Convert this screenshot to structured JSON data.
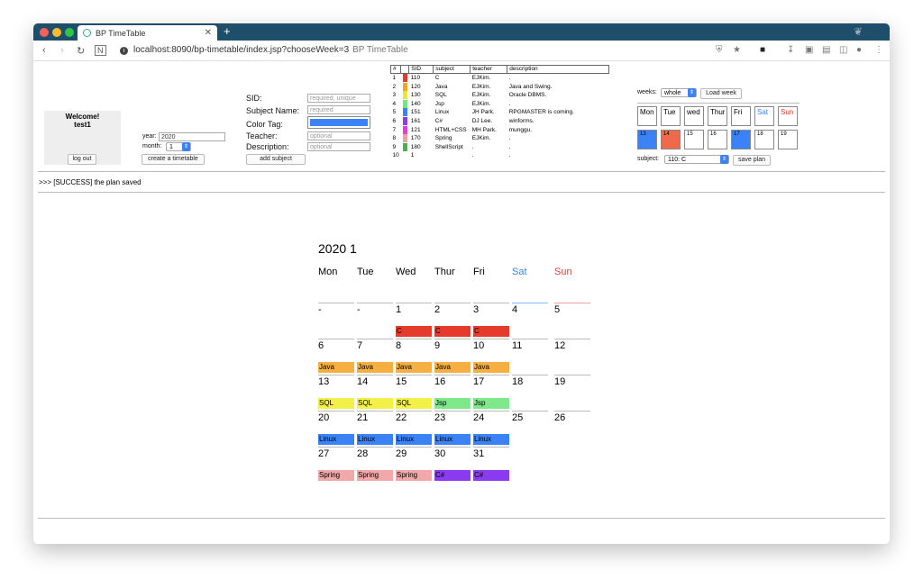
{
  "browser": {
    "tab_title": "BP TimeTable",
    "url": "localhost:8090/bp-timetable/index.jsp?chooseWeek=3",
    "page_title_hint": "BP TimeTable"
  },
  "login": {
    "welcome": "Welcome!",
    "user": "test1",
    "logout_label": "log out"
  },
  "create": {
    "year_label": "year:",
    "year_value": "2020",
    "month_label": "month:",
    "month_value": "1",
    "create_label": "create a timetable"
  },
  "subject_form": {
    "sid_label": "SID:",
    "sid_placeholder": "required, unique",
    "name_label": "Subject Name:",
    "name_placeholder": "required",
    "color_label": "Color Tag:",
    "color_value": "#3b82f6",
    "teacher_label": "Teacher:",
    "teacher_placeholder": "optional",
    "desc_label": "Description:",
    "desc_placeholder": "optional",
    "add_label": "add subject"
  },
  "subject_table": {
    "headers": [
      "#",
      "",
      "SID",
      "subject",
      "teacher",
      "description"
    ],
    "rows": [
      {
        "n": "1",
        "color": "#e53b2c",
        "sid": "110",
        "subject": "C",
        "teacher": "EJKim.",
        "desc": "."
      },
      {
        "n": "2",
        "color": "#f5a623",
        "sid": "120",
        "subject": "Java",
        "teacher": "EJKim.",
        "desc": "Java and Swing."
      },
      {
        "n": "3",
        "color": "#e8e832",
        "sid": "130",
        "subject": "SQL",
        "teacher": "EJKim.",
        "desc": "Oracle DBMS."
      },
      {
        "n": "4",
        "color": "#6fe87e",
        "sid": "140",
        "subject": "Jsp",
        "teacher": "EJKim.",
        "desc": "."
      },
      {
        "n": "5",
        "color": "#3b82f6",
        "sid": "151",
        "subject": "Linux",
        "teacher": "JH Park.",
        "desc": "RPGMASTER is coming."
      },
      {
        "n": "6",
        "color": "#8b3bf0",
        "sid": "161",
        "subject": "C#",
        "teacher": "DJ Lee.",
        "desc": "winforms."
      },
      {
        "n": "7",
        "color": "#e83bd8",
        "sid": "121",
        "subject": "HTML+CSS",
        "teacher": "MH Park.",
        "desc": "munggu."
      },
      {
        "n": "8",
        "color": "#f0a0a0",
        "sid": "170",
        "subject": "Spring",
        "teacher": "EJKim.",
        "desc": "."
      },
      {
        "n": "9",
        "color": "#4caf50",
        "sid": "180",
        "subject": "ShellScript",
        "teacher": ".",
        "desc": "."
      },
      {
        "n": "10",
        "color": "",
        "sid": "1",
        "subject": "",
        "teacher": ".",
        "desc": "."
      }
    ]
  },
  "week_panel": {
    "weeks_label": "weeks:",
    "weeks_value": "whole",
    "load_label": "Load week",
    "days": [
      {
        "name": "Mon",
        "color": "#000000",
        "num": "13",
        "fill": "#3b82f6"
      },
      {
        "name": "Tue",
        "color": "#000000",
        "num": "14",
        "fill": "#ef6a4c"
      },
      {
        "name": "wed",
        "color": "#000000",
        "num": "15",
        "fill": ""
      },
      {
        "name": "Thur",
        "color": "#000000",
        "num": "16",
        "fill": ""
      },
      {
        "name": "Fri",
        "color": "#000000",
        "num": "17",
        "fill": "#3b82f6"
      },
      {
        "name": "Sat",
        "color": "#3b82f6",
        "num": "18",
        "fill": ""
      },
      {
        "name": "Sun",
        "color": "#e53b2c",
        "num": "19",
        "fill": ""
      }
    ],
    "subject_label": "subject:",
    "subject_value": "110: C",
    "save_label": "save plan"
  },
  "message": ">>> [SUCCESS] the plan saved",
  "calendar": {
    "title": "2020 1",
    "dow": [
      {
        "label": "Mon",
        "color": "#000000"
      },
      {
        "label": "Tue",
        "color": "#000000"
      },
      {
        "label": "Wed",
        "color": "#000000"
      },
      {
        "label": "Thur",
        "color": "#000000"
      },
      {
        "label": "Fri",
        "color": "#000000"
      },
      {
        "label": "Sat",
        "color": "#3b82f6"
      },
      {
        "label": "Sun",
        "color": "#e53b2c"
      }
    ],
    "weeks": [
      [
        {
          "num": "-",
          "line": "#bbbbbb",
          "bar": "",
          "bar_color": ""
        },
        {
          "num": "-",
          "line": "#bbbbbb",
          "bar": "",
          "bar_color": ""
        },
        {
          "num": "1",
          "line": "#bbbbbb",
          "bar": "C",
          "bar_color": "#e53b2c"
        },
        {
          "num": "2",
          "line": "#bbbbbb",
          "bar": "C",
          "bar_color": "#e53b2c"
        },
        {
          "num": "3",
          "line": "#bbbbbb",
          "bar": "C",
          "bar_color": "#e53b2c"
        },
        {
          "num": "4",
          "line": "#8ab4f8",
          "bar": "",
          "bar_color": ""
        },
        {
          "num": "5",
          "line": "#f0a0a0",
          "bar": "",
          "bar_color": ""
        }
      ],
      [
        {
          "num": "6",
          "line": "#bbbbbb",
          "bar": "Java",
          "bar_color": "#f5b041"
        },
        {
          "num": "7",
          "line": "#bbbbbb",
          "bar": "Java",
          "bar_color": "#f5b041"
        },
        {
          "num": "8",
          "line": "#bbbbbb",
          "bar": "Java",
          "bar_color": "#f5b041"
        },
        {
          "num": "9",
          "line": "#bbbbbb",
          "bar": "Java",
          "bar_color": "#f5b041"
        },
        {
          "num": "10",
          "line": "#bbbbbb",
          "bar": "Java",
          "bar_color": "#f5b041"
        },
        {
          "num": "11",
          "line": "#bbbbbb",
          "bar": "",
          "bar_color": ""
        },
        {
          "num": "12",
          "line": "#bbbbbb",
          "bar": "",
          "bar_color": ""
        }
      ],
      [
        {
          "num": "13",
          "line": "#bbbbbb",
          "bar": "SQL",
          "bar_color": "#f4f04a"
        },
        {
          "num": "14",
          "line": "#bbbbbb",
          "bar": "SQL",
          "bar_color": "#f4f04a"
        },
        {
          "num": "15",
          "line": "#bbbbbb",
          "bar": "SQL",
          "bar_color": "#f4f04a"
        },
        {
          "num": "16",
          "line": "#bbbbbb",
          "bar": "Jsp",
          "bar_color": "#7ee88a"
        },
        {
          "num": "17",
          "line": "#bbbbbb",
          "bar": "Jsp",
          "bar_color": "#7ee88a"
        },
        {
          "num": "18",
          "line": "#bbbbbb",
          "bar": "",
          "bar_color": ""
        },
        {
          "num": "19",
          "line": "#bbbbbb",
          "bar": "",
          "bar_color": ""
        }
      ],
      [
        {
          "num": "20",
          "line": "#bbbbbb",
          "bar": "Linux",
          "bar_color": "#3b82f6"
        },
        {
          "num": "21",
          "line": "#bbbbbb",
          "bar": "Linux",
          "bar_color": "#3b82f6"
        },
        {
          "num": "22",
          "line": "#bbbbbb",
          "bar": "Linux",
          "bar_color": "#3b82f6"
        },
        {
          "num": "23",
          "line": "#bbbbbb",
          "bar": "Linux",
          "bar_color": "#3b82f6"
        },
        {
          "num": "24",
          "line": "#bbbbbb",
          "bar": "Linux",
          "bar_color": "#3b82f6"
        },
        {
          "num": "25",
          "line": "#bbbbbb",
          "bar": "",
          "bar_color": ""
        },
        {
          "num": "26",
          "line": "#bbbbbb",
          "bar": "",
          "bar_color": ""
        }
      ],
      [
        {
          "num": "27",
          "line": "#bbbbbb",
          "bar": "Spring",
          "bar_color": "#f0a8a8"
        },
        {
          "num": "28",
          "line": "#bbbbbb",
          "bar": "Spring",
          "bar_color": "#f0a8a8"
        },
        {
          "num": "29",
          "line": "#bbbbbb",
          "bar": "Spring",
          "bar_color": "#f0a8a8"
        },
        {
          "num": "30",
          "line": "#bbbbbb",
          "bar": "C#",
          "bar_color": "#8b3bf0"
        },
        {
          "num": "31",
          "line": "#bbbbbb",
          "bar": "C#",
          "bar_color": "#8b3bf0"
        },
        {
          "num": "",
          "line": "",
          "bar": "",
          "bar_color": ""
        },
        {
          "num": "",
          "line": "",
          "bar": "",
          "bar_color": ""
        }
      ]
    ]
  }
}
